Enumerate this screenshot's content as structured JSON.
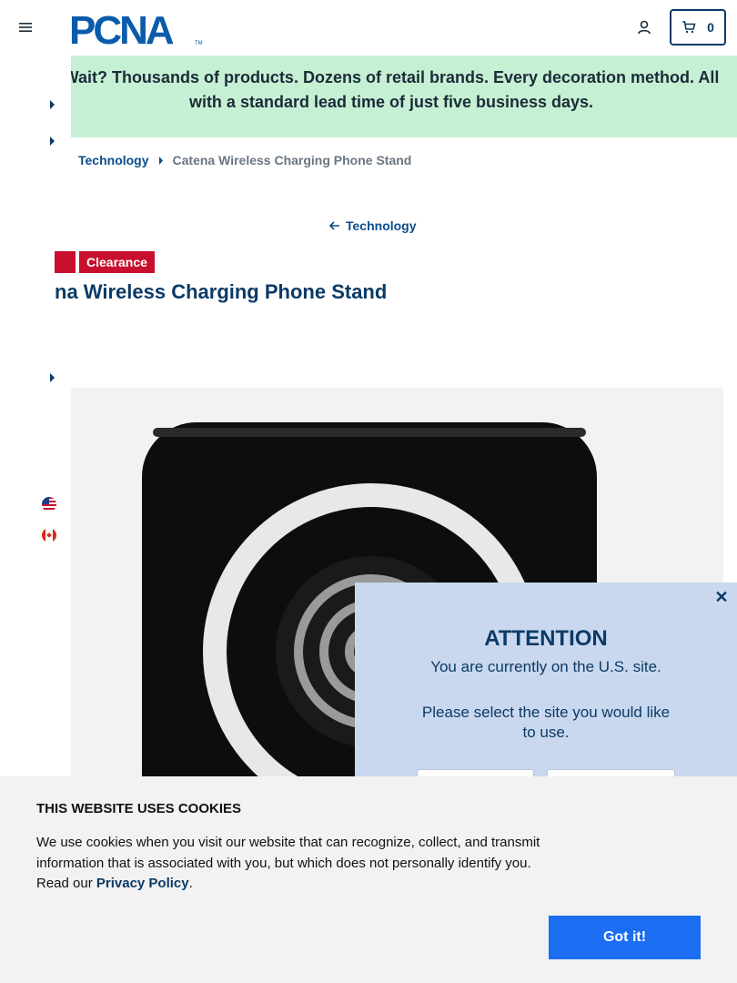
{
  "header": {
    "logo_text": "PCNA",
    "logo_tm": "TM",
    "cart_count": "0"
  },
  "banner": {
    "text_line1": "Wait? Thousands of products. Dozens of retail brands. Every decoration method. All",
    "text_line2": "with a standard lead time of just five business days."
  },
  "breadcrumb": {
    "items": [
      "Technology",
      "Catena Wireless Charging Phone Stand"
    ]
  },
  "back_link": "Technology",
  "product": {
    "badge": "Clearance",
    "title": "na Wireless Charging Phone Stand"
  },
  "modal": {
    "title": "ATTENTION",
    "line1": "You are currently on the U.S. site.",
    "line2": "Please select the site you would like to use."
  },
  "cookie": {
    "title": "THIS WEBSITE USES COOKIES",
    "body": "We use cookies when you visit our website that can recognize, collect, and transmit information that is associated with you, but which does not personally identify you. Read our ",
    "link": "Privacy Policy",
    "after_link": ".",
    "button": "Got it!"
  },
  "colors": {
    "brand_navy": "#0b3a66",
    "banner_green": "#c6f0d4",
    "clearance_red": "#c8102e",
    "cookie_button_blue": "#1b6df2",
    "modal_blue": "#c9d8ee"
  }
}
